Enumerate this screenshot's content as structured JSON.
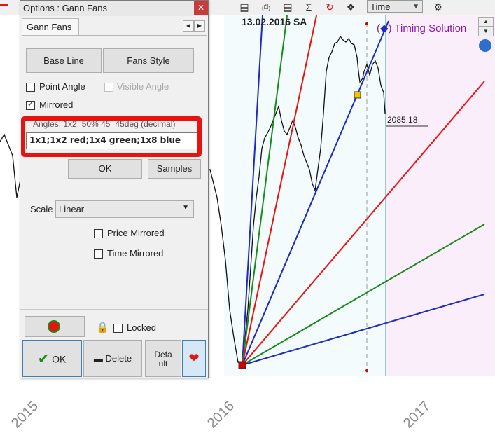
{
  "toolbar": {
    "time_select": "Time",
    "icons": [
      "document-icon",
      "printer-icon",
      "chart-icon",
      "sigma-icon",
      "refresh-icon",
      "nodes-icon",
      "gear-icon"
    ]
  },
  "chart": {
    "date_label": "13.02.2016 SA",
    "brand_label": "Timing Solution",
    "price_label": "2085.18",
    "x_ticks": [
      "2015",
      "2016",
      "2017"
    ],
    "colors": {
      "red": "#e8120e",
      "green": "#1a8a1a",
      "blue": "#1f29c4",
      "teal": "#3a9aa8",
      "pink": "#fbeefb"
    }
  },
  "dialog": {
    "title": "Options : Gann Fans",
    "close_icon": "close-icon",
    "tab": "Gann Fans",
    "base_line_button": "Base Line",
    "fans_style_button": "Fans Style",
    "point_angle_label": "Point Angle",
    "point_angle_checked": false,
    "visible_angle_label": "Visible Angle",
    "visible_angle_checked": false,
    "mirrored_label": "Mirrored",
    "mirrored_checked": true,
    "angles_hint": "Angles: 1x2=50% 45=45deg (decimal)",
    "angles_value": "1x1;1x2 red;1x4 green;1x8 blue",
    "ok_small_button": "OK",
    "samples_button": "Samples",
    "scale_label": "Scale",
    "scale_value": "Linear",
    "price_mirrored_label": "Price Mirrored",
    "price_mirrored_checked": false,
    "time_mirrored_label": "Time Mirrored",
    "time_mirrored_checked": false,
    "locked_label": "Locked",
    "locked_checked": false,
    "ok_button": "OK",
    "delete_button": "Delete",
    "default_button_line1": "Defa",
    "default_button_line2": "ult"
  }
}
